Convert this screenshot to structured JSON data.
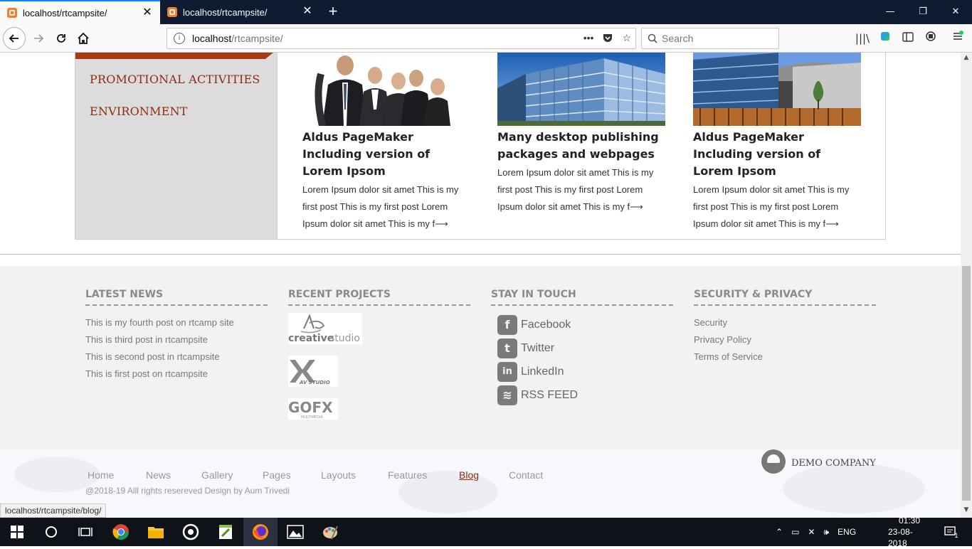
{
  "browser": {
    "tabs": [
      {
        "title": "localhost/rtcampsite/"
      },
      {
        "title": "localhost/rtcampsite/"
      }
    ],
    "new_tab_label": "+",
    "url_host": "localhost",
    "url_path": "/rtcampsite/",
    "search_placeholder": "Search",
    "status_link": "localhost/rtcampsite/blog/"
  },
  "sidebar": {
    "items": [
      {
        "label": "PROMOTIONAL ACTIVITIES"
      },
      {
        "label": "ENVIRONMENT"
      }
    ]
  },
  "posts": [
    {
      "title": "Aldus PageMaker Including version of Lorem Ipsom",
      "excerpt": "Lorem Ipsum dolor sit amet This is my first post This is my first post Lorem Ipsum dolor sit amet This is my f⟶",
      "image": "people"
    },
    {
      "title": "Many desktop publishing packages and webpages",
      "excerpt": "Lorem Ipsum dolor sit amet This is my first post This is my first post Lorem Ipsum dolor sit amet This is my f⟶",
      "image": "building-glass"
    },
    {
      "title": "Aldus PageMaker Including version of Lorem Ipsom",
      "excerpt": "Lorem Ipsum dolor sit amet This is my first post This is my first post Lorem Ipsum dolor sit amet This is my f⟶",
      "image": "building-modern"
    }
  ],
  "footer": {
    "latest_news": {
      "heading": "LATEST NEWS",
      "items": [
        "This is my fourth post on rtcamp site",
        "This is third post in rtcampsite",
        "This is second post in rtcampsite",
        "This is first post on rtcampsite"
      ]
    },
    "recent_projects": {
      "heading": "RECENT PROJECTS",
      "logos": [
        {
          "text_a": "creative",
          "text_b": "studio"
        },
        {
          "text_a": "AV STUDIO"
        },
        {
          "text_a": "GOFX",
          "text_b": "MULTIMEDIA"
        }
      ]
    },
    "stay_in_touch": {
      "heading": "STAY IN TOUCH",
      "links": [
        {
          "label": "Facebook",
          "icon": "facebook-icon",
          "glyph": "f"
        },
        {
          "label": "Twitter",
          "icon": "twitter-icon",
          "glyph": "t"
        },
        {
          "label": "LinkedIn",
          "icon": "linkedin-icon",
          "glyph": "in"
        },
        {
          "label": "RSS FEED",
          "icon": "rss-icon",
          "glyph": "≋"
        }
      ]
    },
    "security": {
      "heading": "SECURITY & PRIVACY",
      "items": [
        "Security",
        "Privacy Policy",
        "Terms of Service"
      ]
    }
  },
  "bottom": {
    "nav": [
      "Home",
      "News",
      "Gallery",
      "Pages",
      "Layouts",
      "Features",
      "Blog",
      "Contact"
    ],
    "active_nav": "Blog",
    "copyright": "@2018-19 Alll rights resereved Design by Aum Trivedi",
    "company": "DEMO COMPANY"
  },
  "taskbar": {
    "lang": "ENG",
    "time": "01:30",
    "date": "23-08-2018",
    "notifications": "1"
  },
  "colors": {
    "accent": "#8b2e10",
    "tab_accent": "#0a84ff"
  }
}
